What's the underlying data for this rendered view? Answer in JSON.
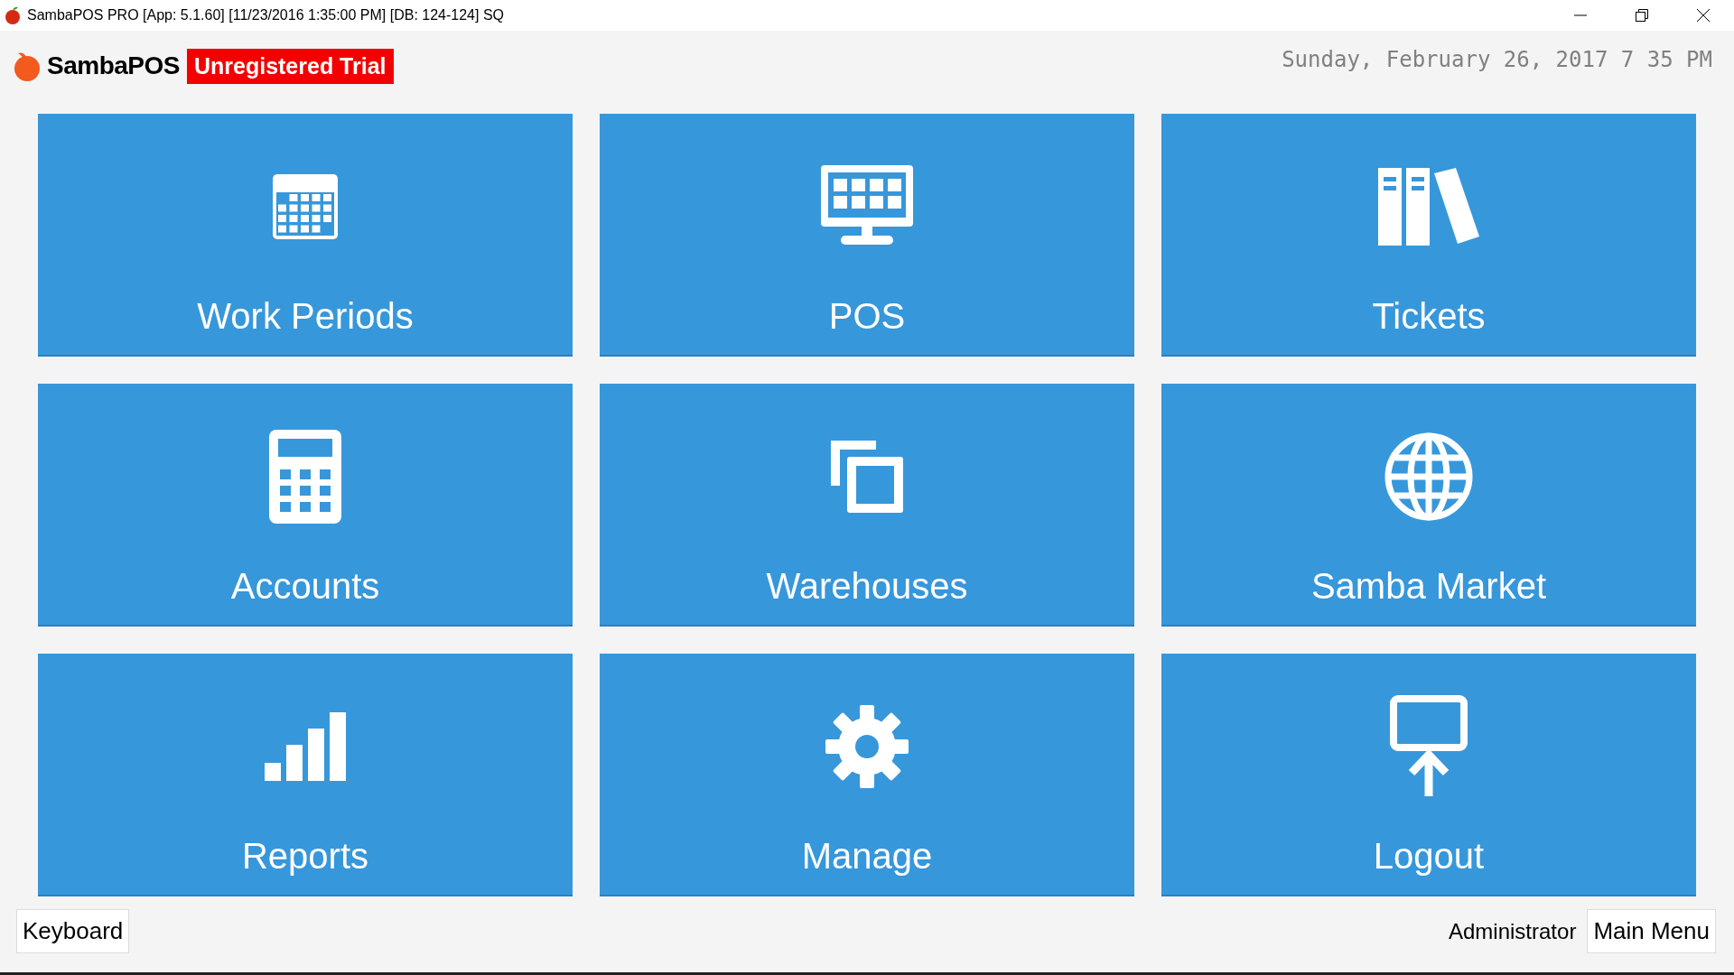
{
  "window": {
    "title": "SambaPOS PRO [App: 5.1.60] [11/23/2016 1:35:00 PM] [DB: 124-124] SQ"
  },
  "header": {
    "brand": "SambaPOS",
    "badge": "Unregistered Trial",
    "datetime": "Sunday, February 26, 2017 7 35 PM"
  },
  "tiles": [
    {
      "kind": "periods",
      "label": "Work Periods"
    },
    {
      "kind": "pos",
      "label": "POS"
    },
    {
      "kind": "tickets",
      "label": "Tickets"
    },
    {
      "kind": "accounts",
      "label": "Accounts"
    },
    {
      "kind": "warehouses",
      "label": "Warehouses"
    },
    {
      "kind": "market",
      "label": "Samba Market"
    },
    {
      "kind": "reports",
      "label": "Reports"
    },
    {
      "kind": "manage",
      "label": "Manage"
    },
    {
      "kind": "logout",
      "label": "Logout"
    }
  ],
  "footer": {
    "keyboard_button": "Keyboard",
    "user": "Administrator",
    "main_menu_button": "Main Menu"
  }
}
